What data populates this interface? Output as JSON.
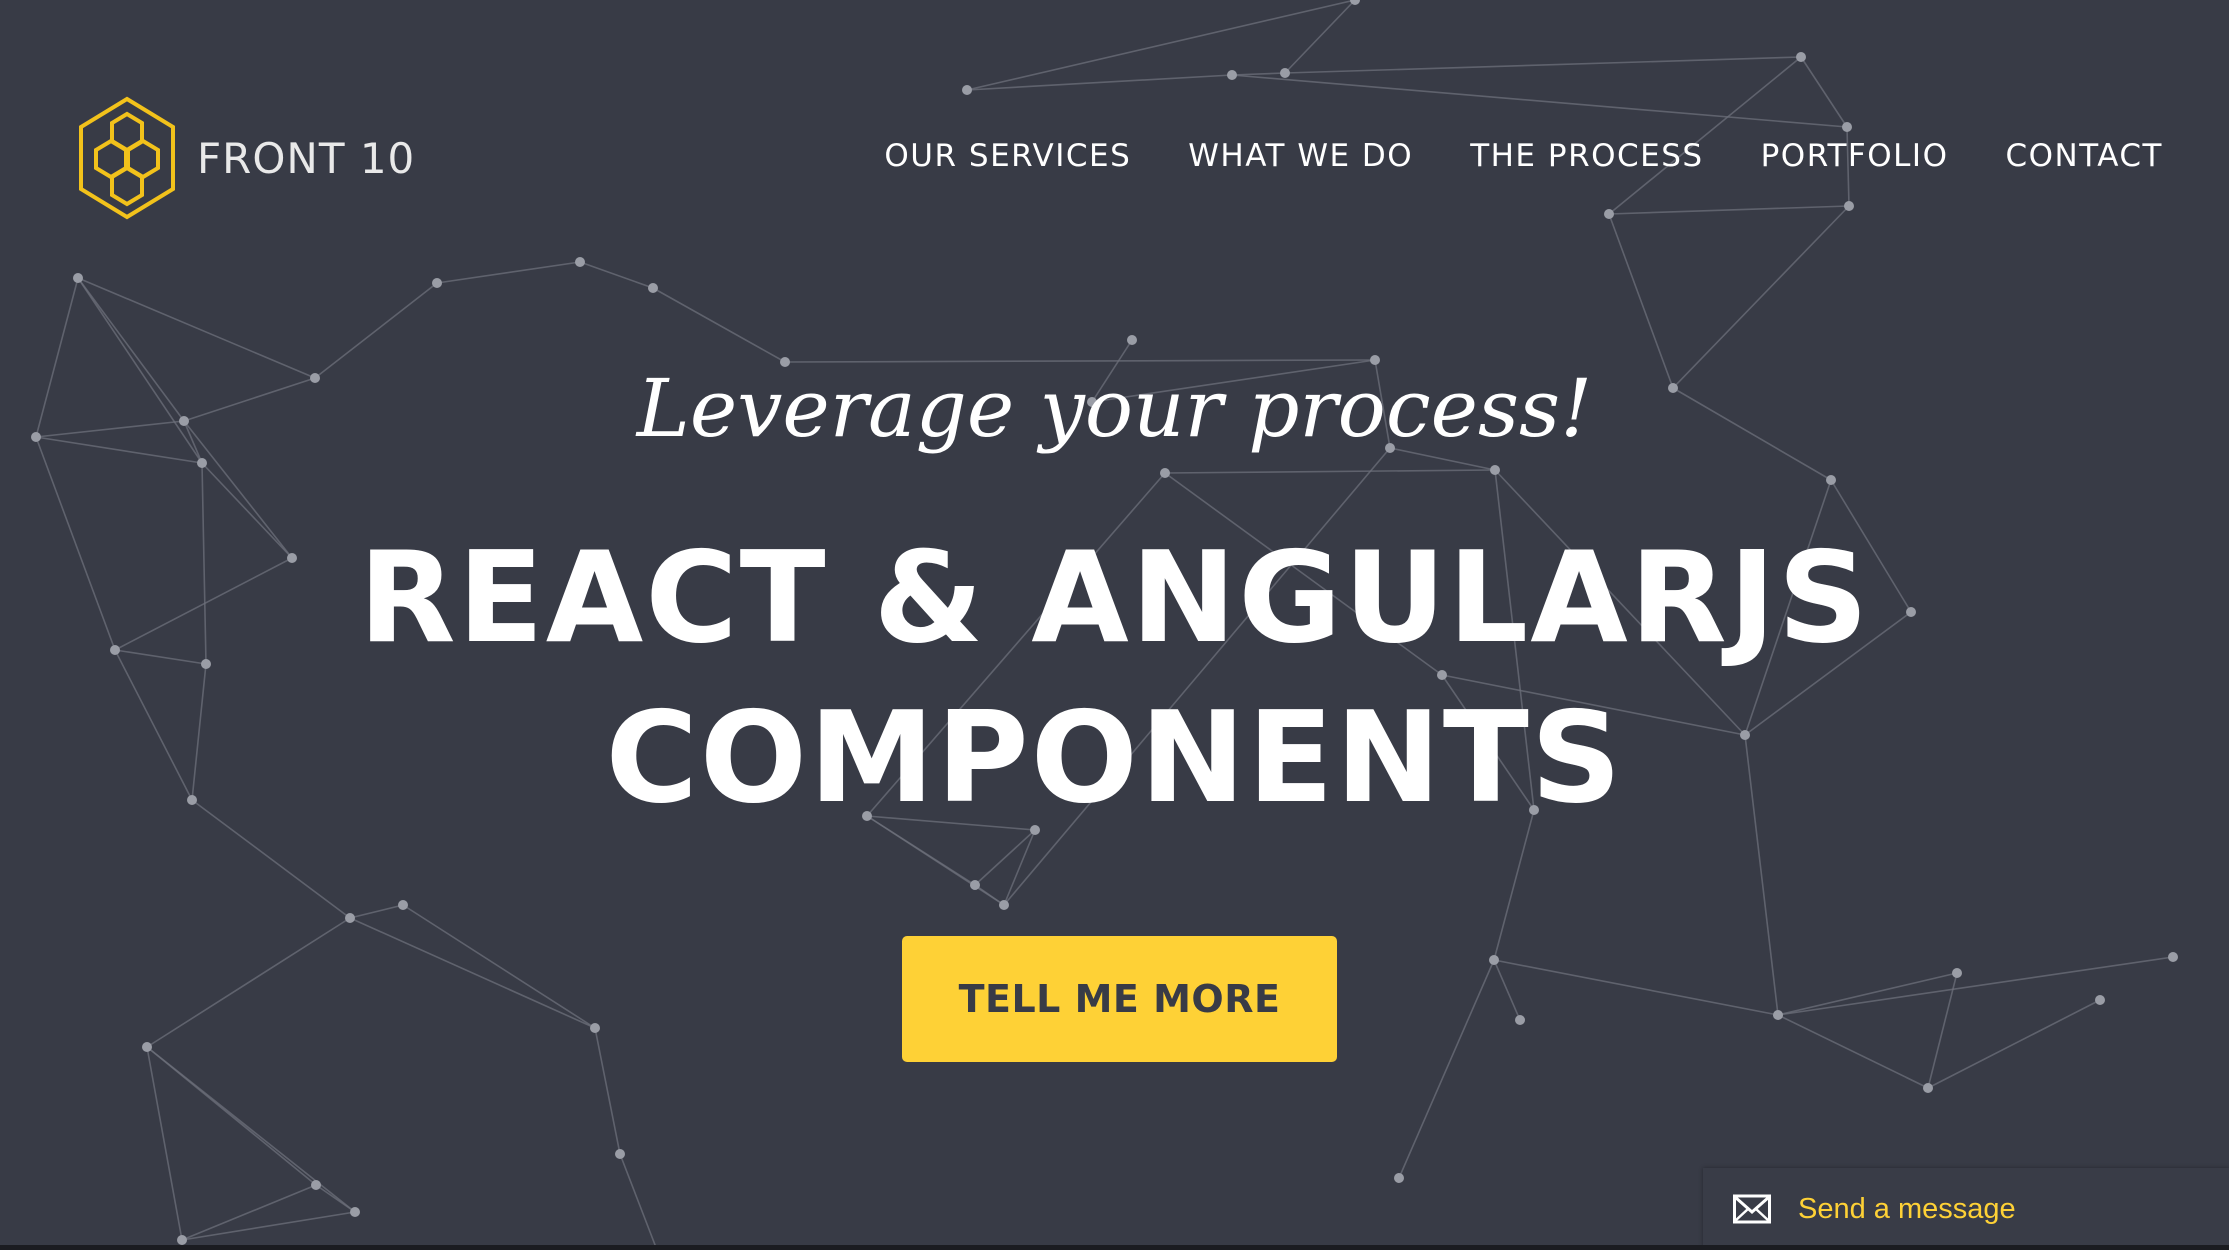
{
  "brand": {
    "name": "FRONT 10",
    "logo_icon": "hexagon-honeycomb-icon",
    "logo_color": "#f2c21b"
  },
  "nav": {
    "items": [
      {
        "label": "OUR SERVICES"
      },
      {
        "label": "WHAT WE DO"
      },
      {
        "label": "THE PROCESS"
      },
      {
        "label": "PORTFOLIO"
      },
      {
        "label": "CONTACT"
      }
    ]
  },
  "hero": {
    "tagline": "Leverage your process!",
    "headline_line1": "REACT & ANGULARJS",
    "headline_line2": "COMPONENTS",
    "cta_label": "TELL ME MORE"
  },
  "message_widget": {
    "icon": "envelope-icon",
    "label": "Send a message"
  },
  "colors": {
    "background": "#383b46",
    "accent": "#fed136",
    "text": "#ffffff"
  }
}
